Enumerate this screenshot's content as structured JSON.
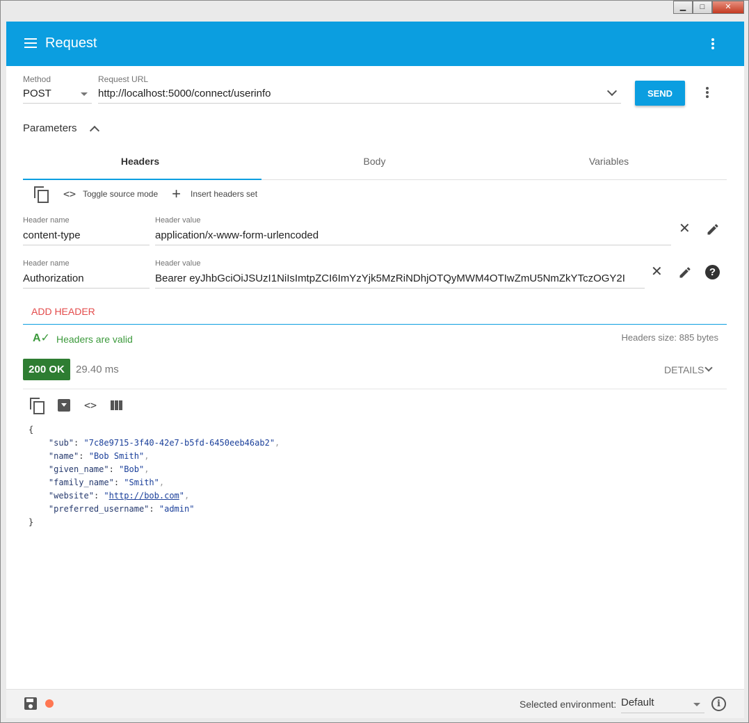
{
  "window": {
    "minimize": "▁",
    "maximize": "□",
    "close": "✕"
  },
  "appbar": {
    "title": "Request"
  },
  "request": {
    "method_label": "Method",
    "method_value": "POST",
    "url_label": "Request URL",
    "url_value": "http://localhost:5000/connect/userinfo",
    "send_label": "SEND"
  },
  "parameters": {
    "label": "Parameters"
  },
  "tabs": [
    {
      "label": "Headers",
      "active": true
    },
    {
      "label": "Body",
      "active": false
    },
    {
      "label": "Variables",
      "active": false
    }
  ],
  "headers_toolbar": {
    "toggle_source_label": "Toggle source mode",
    "insert_set_label": "Insert headers set"
  },
  "headers": [
    {
      "name_label": "Header name",
      "name_value": "content-type",
      "value_label": "Header value",
      "value_value": "application/x-www-form-urlencoded"
    },
    {
      "name_label": "Header name",
      "name_value": "Authorization",
      "value_label": "Header value",
      "value_value": "Bearer eyJhbGciOiJSUzI1NiIsImtpZCI6ImYzYjk5MzRiNDhjOTQyMWM4OTIwZmU5NmZkYTczOGY2I"
    }
  ],
  "add_header_label": "ADD HEADER",
  "validation": {
    "text": "Headers are valid",
    "size_text": "Headers size: 885 bytes"
  },
  "response": {
    "status": "200 OK",
    "time": "29.40 ms",
    "details_label": "DETAILS",
    "body": {
      "sub": "7c8e9715-3f40-42e7-b5fd-6450eeb46ab2",
      "name": "Bob Smith",
      "given_name": "Bob",
      "family_name": "Smith",
      "website": "http://bob.com",
      "preferred_username": "admin"
    }
  },
  "footer": {
    "env_label": "Selected environment:",
    "env_value": "Default"
  },
  "colors": {
    "accent": "#0b9ee0",
    "success": "#2e7d32",
    "valid_text": "#3c9a3c",
    "add_header": "#e34b4b",
    "unsaved_dot": "#ff7752"
  }
}
